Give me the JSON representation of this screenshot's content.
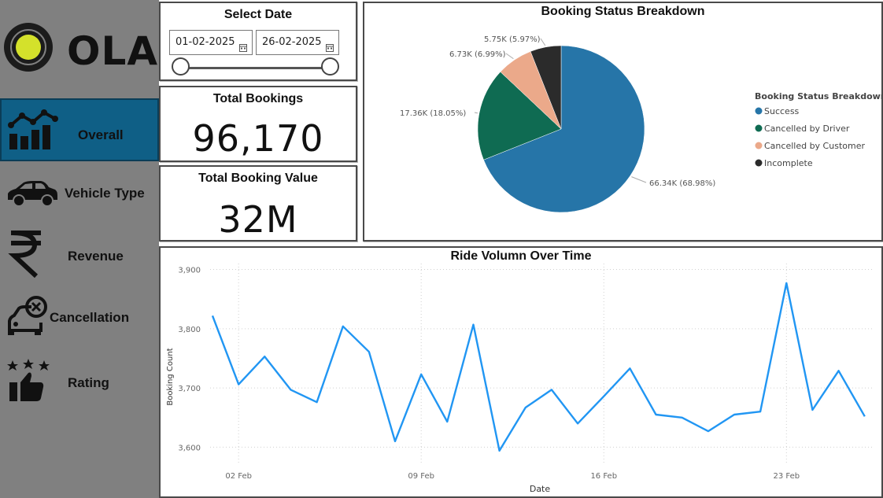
{
  "brand": {
    "name": "OLA"
  },
  "nav": {
    "items": [
      {
        "label": "Overall",
        "icon": "chart-growth-icon",
        "active": true
      },
      {
        "label": "Vehicle Type",
        "icon": "car-icon"
      },
      {
        "label": "Revenue",
        "icon": "rupee-icon"
      },
      {
        "label": "Cancellation",
        "icon": "cancelled-car-icon"
      },
      {
        "label": "Rating",
        "icon": "thumbs-up-stars-icon"
      }
    ]
  },
  "date_filter": {
    "title": "Select Date",
    "start": "01-02-2025",
    "end": "26-02-2025"
  },
  "kpis": {
    "total_bookings": {
      "label": "Total Bookings",
      "value": "96,170"
    },
    "total_booking_value": {
      "label": "Total Booking Value",
      "value": "32M"
    }
  },
  "pie": {
    "title": "Booking Status Breakdown",
    "legend_title": "Booking Status Breakdown"
  },
  "line": {
    "title": "Ride Volumn Over Time"
  },
  "colors": {
    "success": "#2675a8",
    "cancelled_driver": "#0f6b52",
    "cancelled_customer": "#eba98a",
    "incomplete": "#2b2b2b",
    "line": "#2196f3",
    "active_nav": "#0f5f86"
  },
  "chart_data": [
    {
      "type": "pie",
      "title": "Booking Status Breakdown",
      "legend_title": "Booking Status Breakdown",
      "legend_position": "right",
      "slices": [
        {
          "name": "Success",
          "value": 66.34,
          "label": "66.34K (68.98%)",
          "color": "#2675a8"
        },
        {
          "name": "Cancelled by Driver",
          "value": 17.36,
          "label": "17.36K (18.05%)",
          "color": "#0f6b52"
        },
        {
          "name": "Cancelled by Customer",
          "value": 6.73,
          "label": "6.73K (6.99%)",
          "color": "#eba98a"
        },
        {
          "name": "Incomplete",
          "value": 5.75,
          "label": "5.75K (5.97%)",
          "color": "#2b2b2b"
        }
      ]
    },
    {
      "type": "line",
      "title": "Ride Volumn Over Time",
      "xlabel": "Date",
      "ylabel": "Booking Count",
      "x_start_day": 1,
      "x_ticks": [
        {
          "day": 2,
          "label": "02 Feb"
        },
        {
          "day": 9,
          "label": "09 Feb"
        },
        {
          "day": 16,
          "label": "16 Feb"
        },
        {
          "day": 23,
          "label": "23 Feb"
        }
      ],
      "ylim": [
        3570,
        3910
      ],
      "y_ticks": [
        3600,
        3700,
        3800,
        3900
      ],
      "y_tick_labels": [
        "3,600",
        "3,700",
        "3,800",
        "3,900"
      ],
      "grid": true,
      "series": [
        {
          "color": "#2196f3",
          "values": [
            3822,
            3706,
            3753,
            3697,
            3676,
            3804,
            3761,
            3610,
            3723,
            3643,
            3807,
            3594,
            3667,
            3697,
            3640,
            3686,
            3733,
            3655,
            3650,
            3627,
            3655,
            3660,
            3877,
            3663,
            3729,
            3652
          ]
        }
      ]
    }
  ]
}
